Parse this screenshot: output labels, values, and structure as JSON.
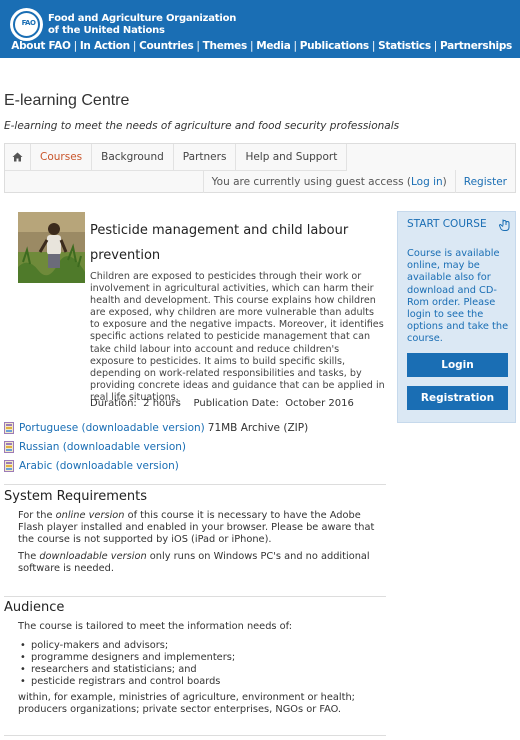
{
  "header": {
    "org_name_line1": "Food and Agriculture Organization",
    "org_name_line2": "of the United Nations",
    "logo_text": "FAO",
    "nav": [
      "About FAO",
      "In Action",
      "Countries",
      "Themes",
      "Media",
      "Publications",
      "Statistics",
      "Partnerships"
    ],
    "nav_separator": "|"
  },
  "site": {
    "title": "E-learning Centre",
    "subtitle": "E-learning to meet the needs of agriculture and food security professionals"
  },
  "tabs": {
    "home_icon": "home-icon",
    "items": [
      "Courses",
      "Background",
      "Partners",
      "Help and Support"
    ],
    "access_prefix": "You are currently using guest access (",
    "login_link": "Log in",
    "access_suffix": ")",
    "register": "Register"
  },
  "course": {
    "title": "Pesticide management and child labour prevention",
    "description": "Children are exposed to pesticides through their work or involvement in agricultural activities, which can harm their health and development. This course explains how children are exposed, why children are more vulnerable than adults to exposure and the negative impacts. Moreover, it identifies specific actions related to pesticide management that can take child labour into account and reduce children's exposure to pesticides. It aims to build specific skills, depending on work-related responsibilities and tasks, by providing concrete ideas and guidance that can be applied in real life situations.",
    "duration_label": "Duration:",
    "duration_value": "2 hours",
    "pubdate_label": "Publication Date:",
    "pubdate_value": "October 2016",
    "downloads": [
      {
        "label": "Portuguese (downloadable version)",
        "extra": "71MB Archive (ZIP)"
      },
      {
        "label": "Russian (downloadable version)",
        "extra": ""
      },
      {
        "label": "Arabic (downloadable version)",
        "extra": ""
      }
    ]
  },
  "system_requirements": {
    "title": "System Requirements",
    "p1_a": "For the ",
    "p1_em": "online version",
    "p1_b": " of this course it is necessary to have the Adobe Flash player installed and enabled in your browser. Please be aware that the course is not supported by iOS (iPad or iPhone).",
    "p2_a": "The ",
    "p2_em": "downloadable version",
    "p2_b": " only runs on Windows PC's and no additional software is needed."
  },
  "audience": {
    "title": "Audience",
    "intro": "The course is tailored to meet the information needs of:",
    "items": [
      "policy-makers and advisors;",
      "programme designers and implementers;",
      "researchers and statisticians; and",
      "pesticide registrars and control boards"
    ],
    "outro": "within, for example, ministries of agriculture, environment or health; producers organizations; private sector enterprises, NGOs or FAO."
  },
  "start_course": {
    "title": "START COURSE",
    "icon": "cursor-hand-icon",
    "text": "Course is available online, may be available also for download and CD-Rom order. Please login to see the options and take the course.",
    "login_button": "Login",
    "registration_button": "Registration"
  },
  "colors": {
    "brand_blue": "#1a6eb4",
    "active_tab": "#c9552b",
    "box_bg": "#dbe8f4"
  }
}
